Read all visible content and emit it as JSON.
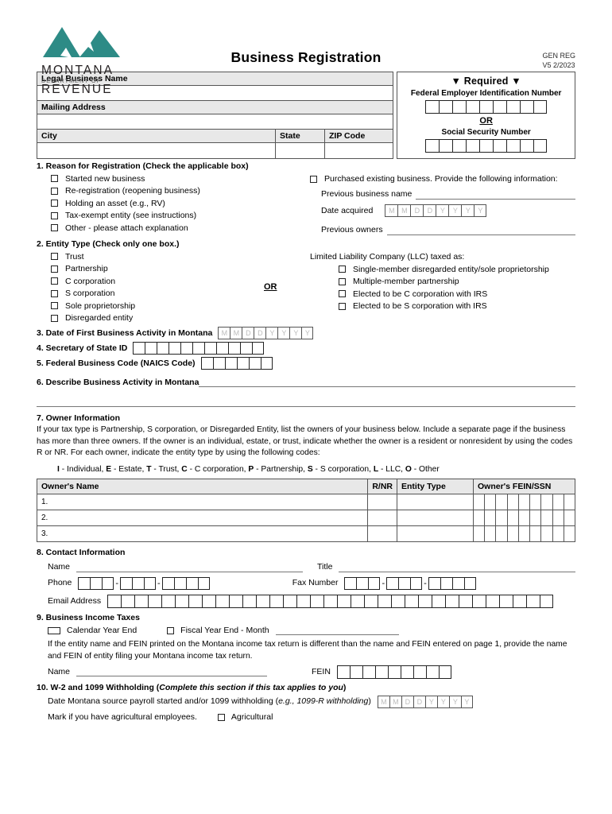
{
  "header": {
    "logo_montana": "MONTANA",
    "logo_dept": "DEPARTMENT OF",
    "logo_revenue": "REVENUE",
    "title": "Business Registration",
    "form_code": "GEN REG",
    "form_version": "V5 2/2023",
    "logo_color": "#2d8b86"
  },
  "business_info": {
    "legal_name_label": "Legal Business Name",
    "legal_name_value": "",
    "mailing_address_label": "Mailing Address",
    "mailing_address_value": "",
    "city_label": "City",
    "city_value": "",
    "state_label": "State",
    "state_value": "",
    "zip_label": "ZIP Code",
    "zip_value": ""
  },
  "required_box": {
    "title": "▼ Required ▼",
    "fein_label": "Federal Employer Identification Number",
    "fein_cells": 9,
    "or_label": "OR",
    "ssn_label": "Social Security Number",
    "ssn_cells": 9
  },
  "section1": {
    "heading": "1. Reason for Registration (Check the applicable box)",
    "options": [
      "Started new business",
      "Re-registration (reopening business)",
      "Holding an asset (e.g., RV)",
      "Tax-exempt entity (see instructions)",
      "Other - please attach explanation"
    ],
    "purchased_option": "Purchased existing business. Provide the following information:",
    "previous_business_name_label": "Previous business name",
    "previous_business_name_value": "",
    "date_acquired_label": "Date acquired",
    "date_acquired_mask": [
      "M",
      "M",
      "D",
      "D",
      "Y",
      "Y",
      "Y",
      "Y"
    ],
    "previous_owners_label": "Previous owners",
    "previous_owners_value": ""
  },
  "section2": {
    "heading": "2. Entity Type (Check only one box.)",
    "options": [
      "Trust",
      "Partnership",
      "C corporation",
      "S corporation",
      "Sole proprietorship",
      "Disregarded entity"
    ],
    "or_label": "OR",
    "llc_heading": "Limited Liability Company (LLC) taxed as:",
    "llc_options": [
      "Single-member disregarded entity/sole proprietorship",
      "Multiple-member partnership",
      "Elected to be C corporation with IRS",
      "Elected to be S corporation with IRS"
    ]
  },
  "section3": {
    "label": "3. Date of First Business Activity in Montana",
    "mask": [
      "M",
      "M",
      "D",
      "D",
      "Y",
      "Y",
      "Y",
      "Y"
    ]
  },
  "section4": {
    "label": "4. Secretary of State ID",
    "cells": 11
  },
  "section5": {
    "label": "5. Federal Business Code (NAICS Code)",
    "cells": 6
  },
  "section6": {
    "label": "6. Describe Business Activity in Montana",
    "value": ""
  },
  "section7": {
    "heading": "7. Owner Information",
    "paragraph": "If your tax type is Partnership, S corporation, or Disregarded Entity, list the owners of your business below. Include a separate page if the business has more than three owners. If the owner is an individual, estate, or trust, indicate whether the owner is a resident or nonresident by using the codes R or NR. For each owner, indicate the entity type by using the following codes:",
    "codes": [
      {
        "letter": "I",
        "desc": " - Individual,"
      },
      {
        "letter": "E",
        "desc": " - Estate,"
      },
      {
        "letter": "T",
        "desc": " - Trust,"
      },
      {
        "letter": "C",
        "desc": " - C corporation,"
      },
      {
        "letter": "P",
        "desc": " - Partnership,"
      },
      {
        "letter": "S",
        "desc": " - S corporation,"
      },
      {
        "letter": "L",
        "desc": " - LLC,"
      },
      {
        "letter": "O",
        "desc": " - Other"
      }
    ],
    "table": {
      "columns": [
        "Owner's Name",
        "R/NR",
        "Entity Type",
        "Owner's FEIN/SSN"
      ],
      "rows": [
        {
          "num": "1.",
          "name": "",
          "rnr": "",
          "entity_type": "",
          "ssn_cells": 9
        },
        {
          "num": "2.",
          "name": "",
          "rnr": "",
          "entity_type": "",
          "ssn_cells": 9
        },
        {
          "num": "3.",
          "name": "",
          "rnr": "",
          "entity_type": "",
          "ssn_cells": 9
        }
      ]
    }
  },
  "section8": {
    "heading": "8. Contact Information",
    "name_label": "Name",
    "name_value": "",
    "title_label": "Title",
    "title_value": "",
    "phone_label": "Phone",
    "phone_groups": [
      3,
      3,
      4
    ],
    "fax_label": "Fax Number",
    "fax_groups": [
      3,
      3,
      4
    ],
    "email_label": "Email Address",
    "email_cells": 33
  },
  "section9": {
    "heading": "9. Business Income Taxes",
    "calendar_option": "Calendar Year End",
    "fiscal_option": "Fiscal Year End - Month",
    "fiscal_value": "",
    "note": "If the entity name and FEIN printed on the Montana income tax return is different than the name and FEIN entered on page 1, provide the name and FEIN of entity filing your Montana income tax return.",
    "name_label": "Name",
    "name_value": "",
    "fein_label": "FEIN",
    "fein_cells": 9
  },
  "section10": {
    "heading_plain": "10. W-2 and 1099 Withholding (",
    "heading_italic": "Complete this section if this tax applies to you",
    "heading_close": ")",
    "date_label_a": "Date Montana source payroll started and/or 1099 withholding (",
    "date_label_italic": "e.g., 1099-R withholding",
    "date_label_close": ")",
    "date_mask": [
      "M",
      "M",
      "D",
      "D",
      "Y",
      "Y",
      "Y",
      "Y"
    ],
    "agricultural_prompt": "Mark if you have agricultural employees.",
    "agricultural_option": "Agricultural"
  }
}
